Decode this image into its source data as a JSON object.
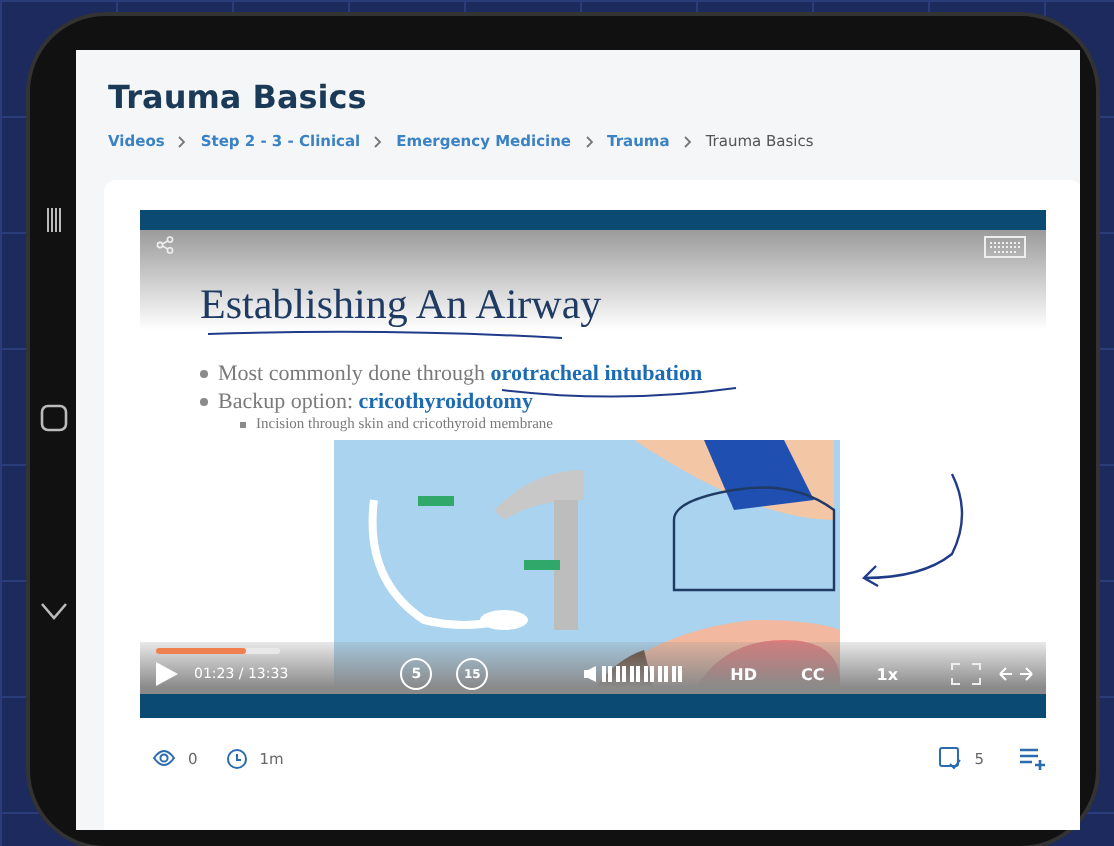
{
  "page": {
    "title": "Trauma Basics",
    "breadcrumb": [
      {
        "label": "Videos",
        "link": true
      },
      {
        "label": "Step 2 - 3 - Clinical",
        "link": true
      },
      {
        "label": "Emergency Medicine",
        "link": true
      },
      {
        "label": "Trauma",
        "link": true
      },
      {
        "label": "Trauma Basics",
        "link": false
      }
    ]
  },
  "slide": {
    "title": "Establishing An Airway",
    "bullets": [
      {
        "text": "Most commonly done through **orotracheal intubation**"
      },
      {
        "text": "Backup option: **cricothyroidotomy**",
        "children": [
          {
            "text": "Incision through skin and cricothyroid membrane"
          }
        ]
      }
    ]
  },
  "player": {
    "progress": {
      "level": 0.73
    },
    "time": "01:23 / 13:33",
    "rewind": "5",
    "forward": "15",
    "volume": {
      "level": 1
    },
    "quality": "HD",
    "captions": "CC",
    "speed": "1x"
  },
  "stats": {
    "views": "0",
    "duration": "1m",
    "questions": "5"
  }
}
